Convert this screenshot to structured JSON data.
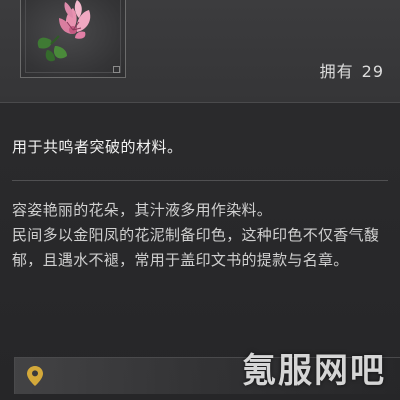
{
  "item": {
    "icon": "pink-flower-icon",
    "owned_label": "拥有",
    "owned_count": "29"
  },
  "description": {
    "usage": "用于共鸣者突破的材料。",
    "lore": [
      "容姿艳丽的花朵，其汁液多用作染料。",
      "民间多以金阳凤的花泥制备印色，这种印色不仅香气馥郁，且遇水不褪，常用于盖印文书的提款与名章。"
    ]
  },
  "location": {
    "icon": "map-pin-icon"
  },
  "watermark": "氪服网吧",
  "colors": {
    "background": "#2a2a2c",
    "header": "#3a3a3c",
    "text_primary": "#f2f2f2",
    "text_secondary": "#cfcfcf",
    "pin": "#d4a93a",
    "flower": "#e892b0"
  }
}
